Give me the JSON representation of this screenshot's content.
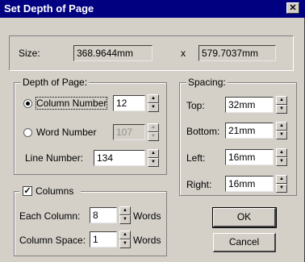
{
  "window": {
    "title": "Set Depth of Page",
    "close_glyph": "✕"
  },
  "size": {
    "label": "Size:",
    "width": "368.9644mm",
    "separator": "x",
    "height": "579.7037mm"
  },
  "depth": {
    "legend": "Depth of Page:",
    "column_number_label": "Column Number",
    "column_number_value": "12",
    "word_number_label": "Word Number",
    "word_number_value": "107",
    "line_number_label": "Line Number:",
    "line_number_value": "134",
    "selected": "column"
  },
  "spacing": {
    "legend": "Spacing:",
    "top_label": "Top:",
    "top_value": "32mm",
    "bottom_label": "Bottom:",
    "bottom_value": "21mm",
    "left_label": "Left:",
    "left_value": "16mm",
    "right_label": "Right:",
    "right_value": "16mm"
  },
  "columns": {
    "legend": "Columns",
    "checked": true,
    "check_glyph": "✓",
    "each_column_label": "Each Column:",
    "each_column_value": "8",
    "each_column_unit": "Words",
    "column_space_label": "Column Space:",
    "column_space_value": "1",
    "column_space_unit": "Words"
  },
  "buttons": {
    "ok": "OK",
    "cancel": "Cancel"
  },
  "spin_glyphs": {
    "up": "▲",
    "down": "▼"
  }
}
